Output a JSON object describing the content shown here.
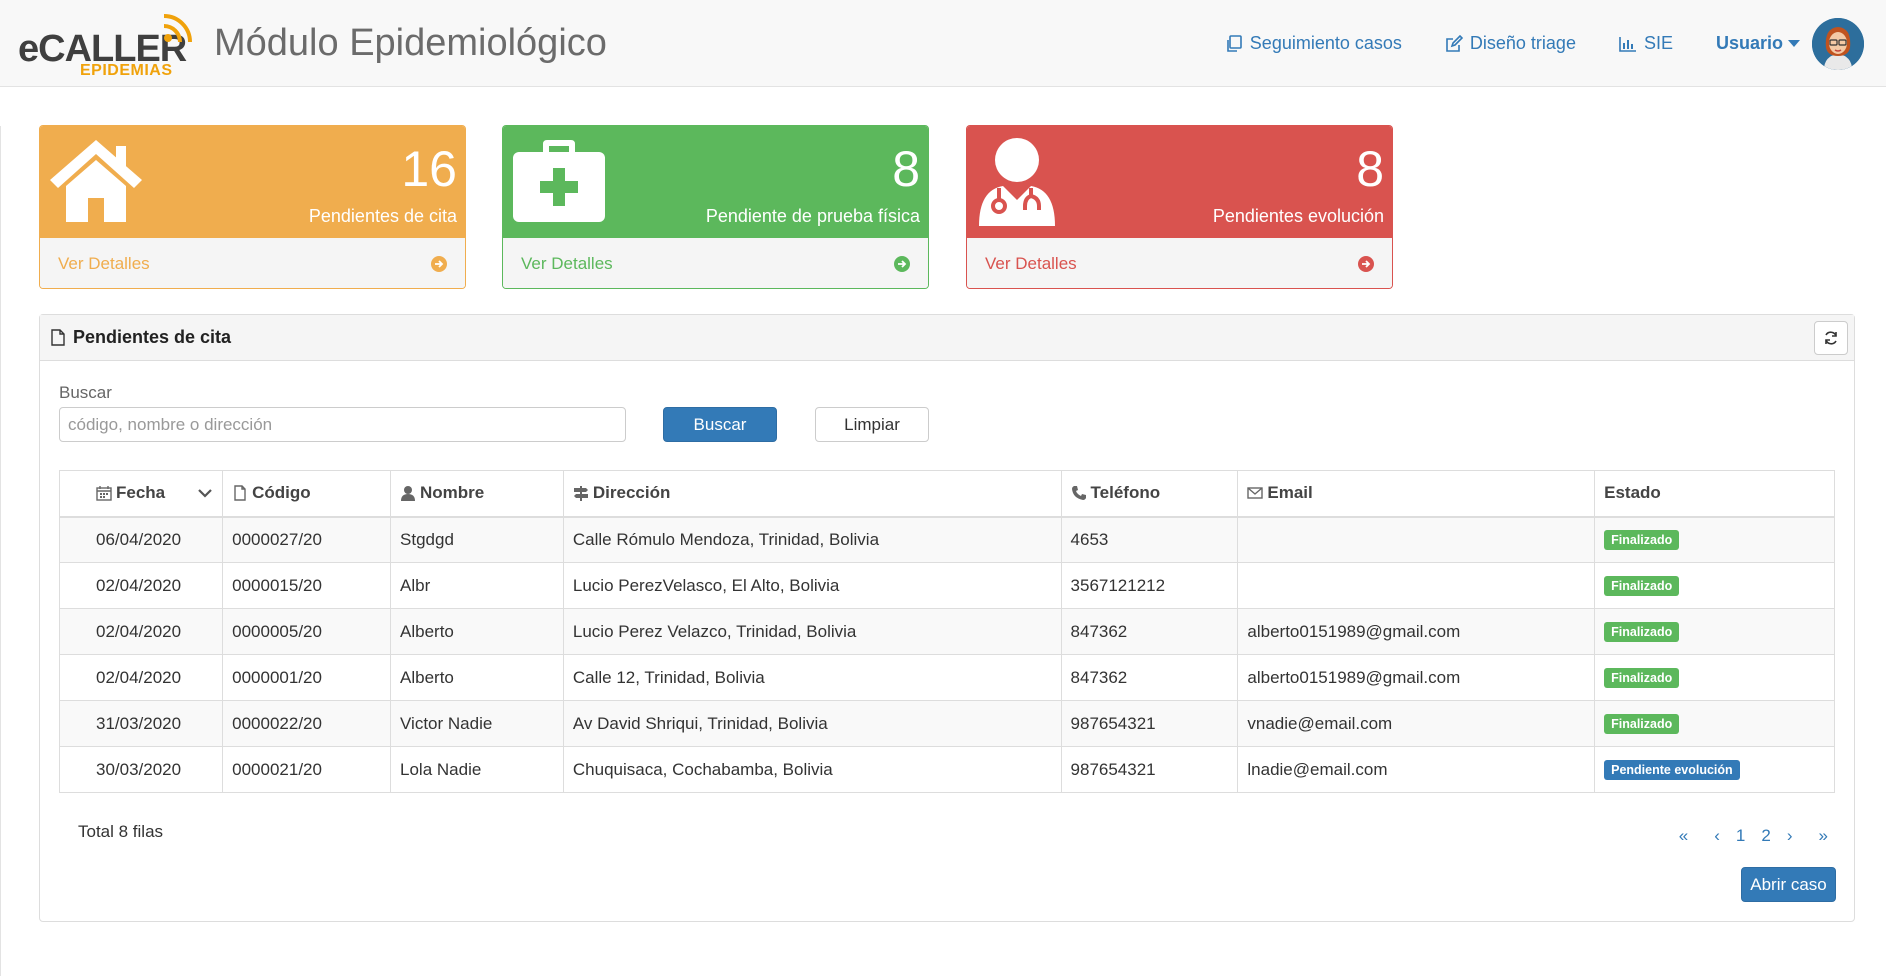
{
  "header": {
    "logo_main": "eCALLER",
    "logo_sub": "EPIDEMIAS",
    "title": "Módulo Epidemiológico",
    "nav": [
      {
        "label": "Seguimiento casos",
        "icon": "copy-icon"
      },
      {
        "label": "Diseño triage",
        "icon": "edit-icon"
      },
      {
        "label": "SIE",
        "icon": "bar-chart-icon"
      }
    ],
    "user_label": "Usuario"
  },
  "stats": [
    {
      "count": "16",
      "label": "Pendientes de cita",
      "link": "Ver Detalles",
      "icon": "home-icon",
      "color": "#f0ad4e"
    },
    {
      "count": "8",
      "label": "Pendiente de prueba física",
      "link": "Ver Detalles",
      "icon": "medkit-icon",
      "color": "#5cb85c"
    },
    {
      "count": "8",
      "label": "Pendientes evolución",
      "link": "Ver Detalles",
      "icon": "user-md-icon",
      "color": "#d9534f"
    }
  ],
  "panel": {
    "title": "Pendientes de cita",
    "search_label": "Buscar",
    "search_placeholder": "código, nombre o dirección",
    "search_value": "",
    "buscar_label": "Buscar",
    "limpiar_label": "Limpiar",
    "columns": [
      "Fecha",
      "Código",
      "Nombre",
      "Dirección",
      "Teléfono",
      "Email",
      "Estado"
    ],
    "rows": [
      {
        "fecha": "06/04/2020",
        "codigo": "0000027/20",
        "nombre": "Stgdgd",
        "direccion": "Calle Rómulo Mendoza, Trinidad, Bolivia",
        "telefono": "4653",
        "email": "",
        "estado": "Finalizado",
        "estado_color": "green"
      },
      {
        "fecha": "02/04/2020",
        "codigo": "0000015/20",
        "nombre": "Albr",
        "direccion": "Lucio PerezVelasco, El Alto, Bolivia",
        "telefono": "3567121212",
        "email": "",
        "estado": "Finalizado",
        "estado_color": "green"
      },
      {
        "fecha": "02/04/2020",
        "codigo": "0000005/20",
        "nombre": "Alberto",
        "direccion": "Lucio Perez Velazco, Trinidad, Bolivia",
        "telefono": "847362",
        "email": "alberto0151989@gmail.com",
        "estado": "Finalizado",
        "estado_color": "green"
      },
      {
        "fecha": "02/04/2020",
        "codigo": "0000001/20",
        "nombre": "Alberto",
        "direccion": "Calle 12, Trinidad, Bolivia",
        "telefono": "847362",
        "email": "alberto0151989@gmail.com",
        "estado": "Finalizado",
        "estado_color": "green"
      },
      {
        "fecha": "31/03/2020",
        "codigo": "0000022/20",
        "nombre": "Victor Nadie",
        "direccion": "Av David Shriqui, Trinidad, Bolivia",
        "telefono": "987654321",
        "email": "vnadie@email.com",
        "estado": "Finalizado",
        "estado_color": "green"
      },
      {
        "fecha": "30/03/2020",
        "codigo": "0000021/20",
        "nombre": "Lola Nadie",
        "direccion": "Chuquisaca, Cochabamba, Bolivia",
        "telefono": "987654321",
        "email": "lnadie@email.com",
        "estado": "Pendiente evolución",
        "estado_color": "blue"
      }
    ],
    "total_label": "Total 8 filas",
    "pager": {
      "first": "«",
      "prev": "‹",
      "pages": [
        "1",
        "2"
      ],
      "next": "›",
      "last": "»"
    },
    "abrir_label": "Abrir caso"
  },
  "colors": {
    "primary": "#337ab7",
    "warning": "#f0ad4e",
    "success": "#5cb85c",
    "danger": "#d9534f"
  }
}
